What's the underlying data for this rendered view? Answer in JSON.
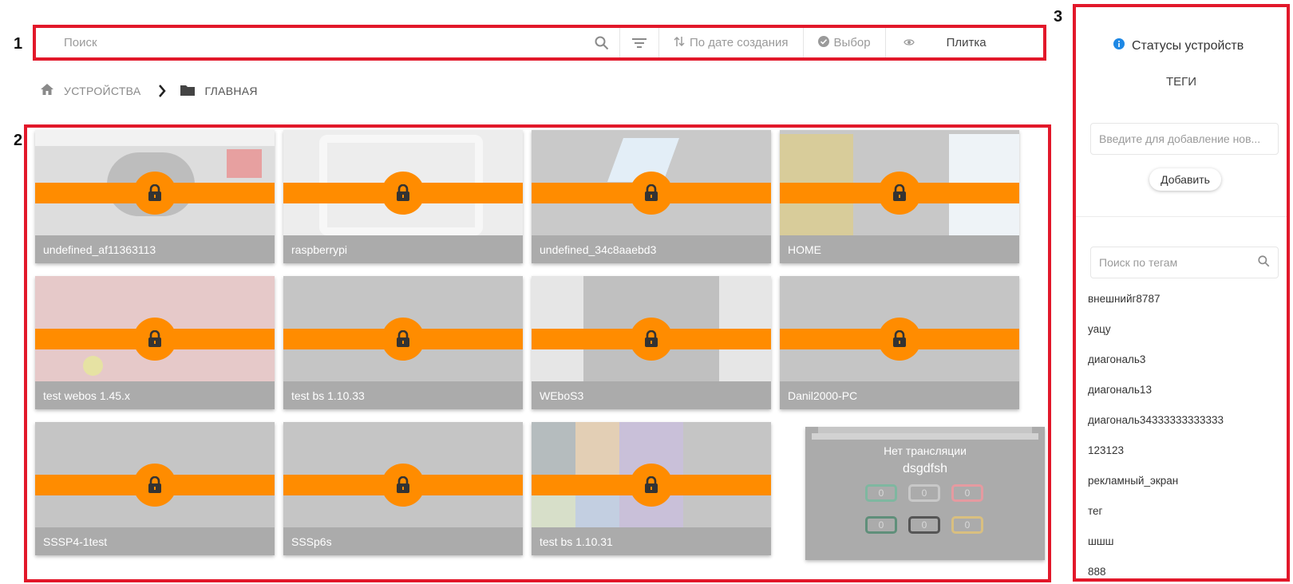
{
  "markers": {
    "toolbar": "1",
    "grid": "2",
    "sidebar": "3"
  },
  "toolbar": {
    "search_placeholder": "Поиск",
    "sort_label": "По дате создания",
    "select_label": "Выбор",
    "view_label": "Плитка"
  },
  "breadcrumb": {
    "home": "УСТРОЙСТВА",
    "current": "ГЛАВНАЯ"
  },
  "devices": [
    {
      "name": "undefined_af11363113",
      "locked": true,
      "thumb": "ad"
    },
    {
      "name": "raspberrypi",
      "locked": true,
      "thumb": "placeholder"
    },
    {
      "name": "undefined_34c8aaebd3",
      "locked": true,
      "thumb": "smartplayer"
    },
    {
      "name": "HOME",
      "locked": true,
      "thumb": "home"
    },
    {
      "name": "test webos 1.45.x",
      "locked": true,
      "thumb": "red"
    },
    {
      "name": "test bs 1.10.33",
      "locked": true,
      "thumb": "blank"
    },
    {
      "name": "WEboS3",
      "locked": true,
      "thumb": "blur"
    },
    {
      "name": "Danil2000-PC",
      "locked": true,
      "thumb": "blank"
    },
    {
      "name": "SSSP4-1test",
      "locked": true,
      "thumb": "blank"
    },
    {
      "name": "SSSp6s",
      "locked": true,
      "thumb": "blank"
    },
    {
      "name": "test bs 1.10.31",
      "locked": true,
      "thumb": "collage"
    }
  ],
  "special_tile": {
    "title": "Нет трансляции",
    "name": "dsgdfsh",
    "badges": [
      {
        "value": "0",
        "color": "#7fb7a0"
      },
      {
        "value": "0",
        "color": "#c8c8c8"
      },
      {
        "value": "0",
        "color": "#e59aa0"
      },
      {
        "value": "0",
        "color": "#5f8f7a"
      },
      {
        "value": "0",
        "color": "#555555"
      },
      {
        "value": "0",
        "color": "#d9bf80"
      }
    ]
  },
  "sidebar": {
    "status_title": "Статусы устройств",
    "tags_title": "ТЕГИ",
    "tag_input_placeholder": "Введите для добавление нов...",
    "add_button": "Добавить",
    "tag_search_placeholder": "Поиск по тегам",
    "tags": [
      "внешнийг8787",
      "уацу",
      "диагональ3",
      "диагональ13",
      "диагональ34333333333333",
      "123123",
      "рекламный_экран",
      "тег",
      "шшш",
      "888"
    ]
  },
  "colors": {
    "highlight": "#e2182a",
    "lock": "#ff8c00",
    "tile_footer": "#ababab",
    "status_info": "#1e88e5"
  }
}
